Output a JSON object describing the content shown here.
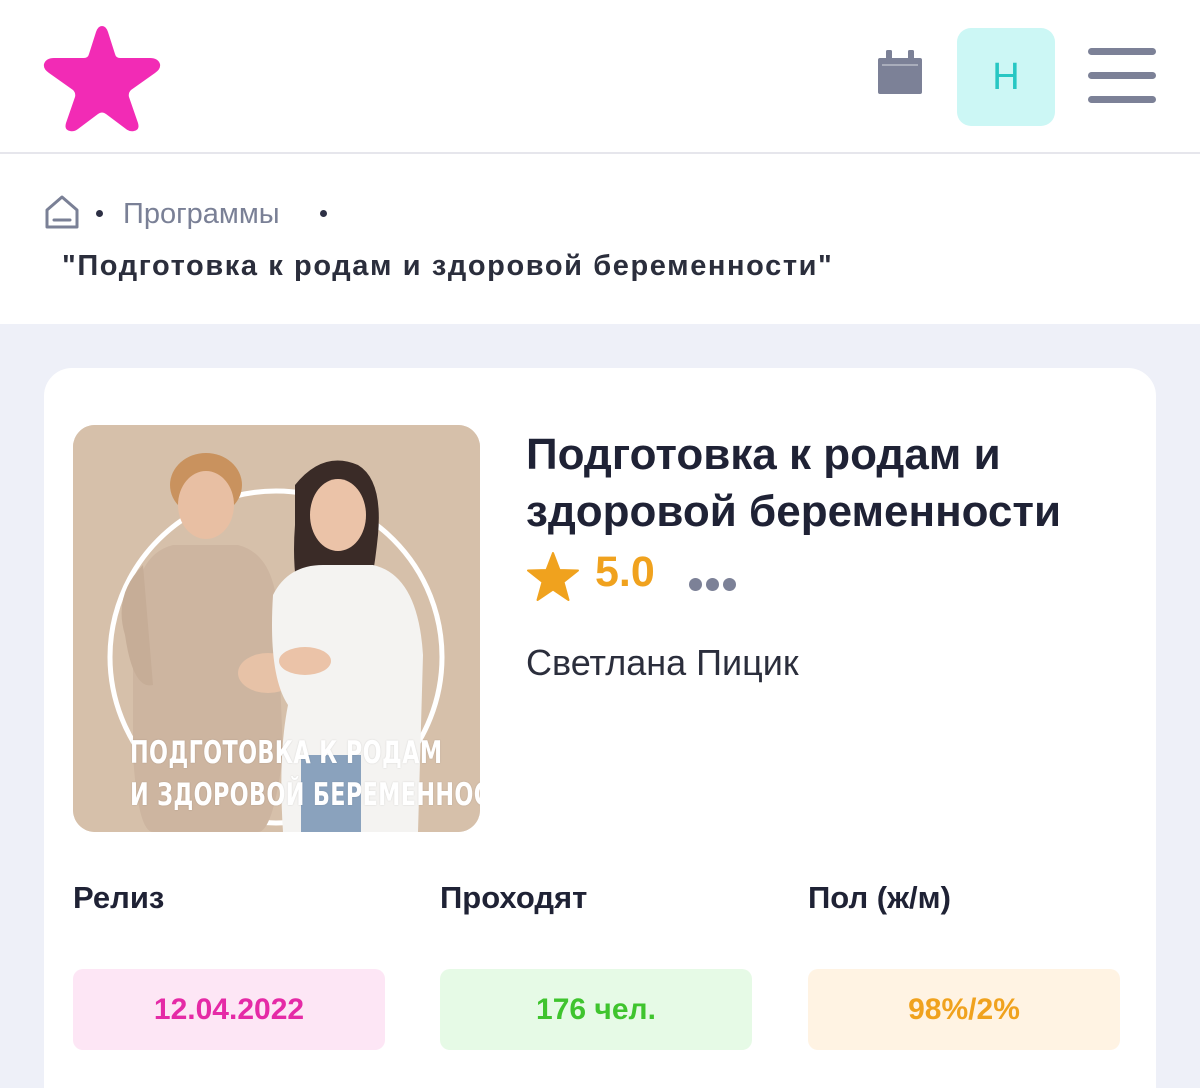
{
  "header": {
    "logo_icon": "star-logo-icon",
    "calendar_icon": "calendar-icon",
    "avatar_letter": "Н",
    "menu_icon": "hamburger-menu-icon",
    "colors": {
      "logo": "#f22bb5",
      "avatar_bg": "#ccf7f5",
      "avatar_text": "#27c7c3",
      "icon": "#7c8197"
    }
  },
  "breadcrumb": {
    "home_icon": "home-icon",
    "programs_label": "Программы",
    "current_label": "\"Подготовка к родам и здоровой беременности\""
  },
  "program": {
    "cover_lines": [
      "ПОДГОТОВКА К РОДАМ",
      "И ЗДОРОВОЙ БЕРЕМЕННОСТИ"
    ],
    "title": "Подготовка к родам и здоровой беременности",
    "rating": "5.0",
    "rating_icon": "star-icon",
    "more_icon": "more-dots-icon",
    "author": "Светлана Пицик"
  },
  "stats": [
    {
      "label": "Релиз",
      "value": "12.04.2022",
      "bg": "#fde6f5",
      "color": "#e52aa6"
    },
    {
      "label": "Проходят",
      "value": "176 чел.",
      "bg": "#e6fae6",
      "color": "#3fc42e"
    },
    {
      "label": "Пол (ж/м)",
      "value": "98%/2%",
      "bg": "#fff3e3",
      "color": "#f0a21e"
    }
  ]
}
